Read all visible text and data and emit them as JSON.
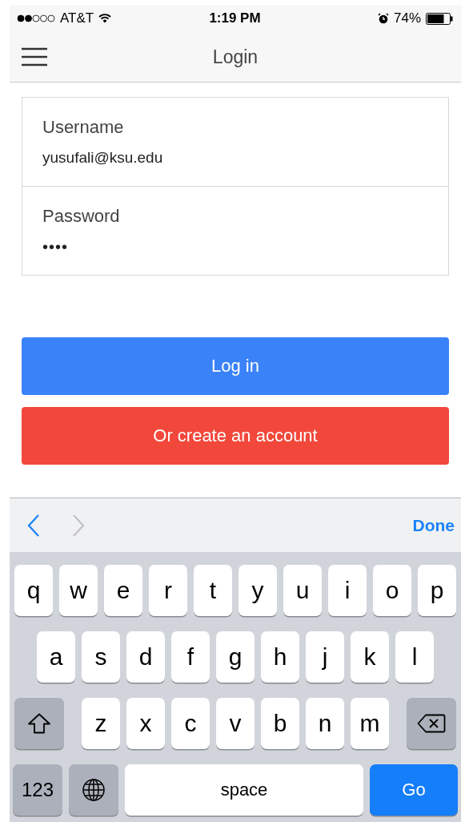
{
  "status_bar": {
    "carrier": "AT&T",
    "time": "1:19 PM",
    "battery": "74%"
  },
  "nav_bar": {
    "title": "Login"
  },
  "form": {
    "fields": [
      {
        "label": "Username",
        "value": "yusufali@ksu.edu",
        "kind": "text"
      },
      {
        "label": "Password",
        "value": "••••",
        "kind": "password"
      }
    ]
  },
  "buttons": [
    {
      "label": "Log in",
      "kind": "primary"
    },
    {
      "label": "Or create an account",
      "kind": "danger"
    }
  ],
  "keyboard_toolbar": {
    "previous_enabled": true,
    "next_enabled": false,
    "done": "Done"
  },
  "keyboard": {
    "rows": [
      {
        "keys": [
          {
            "kind": "letter",
            "label": "q"
          },
          {
            "kind": "letter",
            "label": "w"
          },
          {
            "kind": "letter",
            "label": "e"
          },
          {
            "kind": "letter",
            "label": "r"
          },
          {
            "kind": "letter",
            "label": "t"
          },
          {
            "kind": "letter",
            "label": "y"
          },
          {
            "kind": "letter",
            "label": "u"
          },
          {
            "kind": "letter",
            "label": "i"
          },
          {
            "kind": "letter",
            "label": "o"
          },
          {
            "kind": "letter",
            "label": "p"
          }
        ]
      },
      {
        "keys": [
          {
            "kind": "letter",
            "label": "a"
          },
          {
            "kind": "letter",
            "label": "s"
          },
          {
            "kind": "letter",
            "label": "d"
          },
          {
            "kind": "letter",
            "label": "f"
          },
          {
            "kind": "letter",
            "label": "g"
          },
          {
            "kind": "letter",
            "label": "h"
          },
          {
            "kind": "letter",
            "label": "j"
          },
          {
            "kind": "letter",
            "label": "k"
          },
          {
            "kind": "letter",
            "label": "l"
          }
        ]
      },
      {
        "keys": [
          {
            "kind": "shift"
          },
          {
            "kind": "letter",
            "label": "z"
          },
          {
            "kind": "letter",
            "label": "x"
          },
          {
            "kind": "letter",
            "label": "c"
          },
          {
            "kind": "letter",
            "label": "v"
          },
          {
            "kind": "letter",
            "label": "b"
          },
          {
            "kind": "letter",
            "label": "n"
          },
          {
            "kind": "letter",
            "label": "m"
          },
          {
            "kind": "delete"
          }
        ]
      },
      {
        "keys": [
          {
            "kind": "numbers",
            "label": "123"
          },
          {
            "kind": "globe"
          },
          {
            "kind": "space",
            "label": "space"
          },
          {
            "kind": "go",
            "label": "Go"
          }
        ]
      }
    ]
  }
}
